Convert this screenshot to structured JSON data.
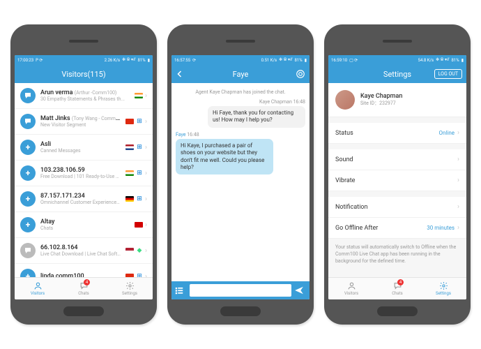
{
  "phone1": {
    "status": {
      "time": "17:00:23",
      "speed": "2.26 K/s",
      "battery": "81%"
    },
    "header": {
      "title": "Visitors(115)"
    },
    "visitors": [
      {
        "icon": "chat",
        "name": "Arun verma",
        "sub": "(Arthur -Comm100)",
        "desc": "30 Empathy Statements & Phrases th...",
        "flag": "in",
        "os": "apple"
      },
      {
        "icon": "chat",
        "name": "Matt Jinks",
        "sub": "(Tony Wang - Comm1...",
        "desc": "New Visitor Segment",
        "flag": "cn",
        "os": "win"
      },
      {
        "icon": "plus",
        "name": "Asli",
        "sub": "",
        "desc": "Canned Messages",
        "flag": "nl",
        "os": "win"
      },
      {
        "icon": "plus",
        "name": "103.238.106.59",
        "sub": "",
        "desc": "Free Download | 101 Ready-to-Use Liv...",
        "flag": "in",
        "os": "win"
      },
      {
        "icon": "plus",
        "name": "87.157.171.234",
        "sub": "",
        "desc": "Omnichannel Customer Experience P...",
        "flag": "de",
        "os": "win"
      },
      {
        "icon": "plus",
        "name": "Altay",
        "sub": "",
        "desc": "Chats",
        "flag": "mk",
        "os": ""
      },
      {
        "icon": "grey",
        "name": "66.102.8.164",
        "sub": "",
        "desc": "Live Chat Download | Live Chat Softw...",
        "flag": "us",
        "os": "android"
      },
      {
        "icon": "plus",
        "name": "linda comm100",
        "sub": "",
        "desc": "",
        "flag": "cn",
        "os": "win"
      }
    ],
    "tabs": {
      "visitors": "Visitors",
      "chats": "Chats",
      "settings": "Settings",
      "badge": "4"
    }
  },
  "phone2": {
    "status": {
      "time": "16:57:55",
      "speed": "0.51 K/s",
      "battery": "81%"
    },
    "header": {
      "title": "Faye"
    },
    "chat": {
      "join": "Agent Kaye Chapman has joined the chat.",
      "msg1": {
        "name": "Kaye Chapman",
        "time": "16:48",
        "text": "Hi Faye, thank you for contacting us! How may I help you?"
      },
      "msg2": {
        "name": "Faye",
        "time": "16:48",
        "text": "Hi Kaye, I purchased a pair of shoes on your website but they don't fit me well. Could you please help?"
      }
    }
  },
  "phone3": {
    "status": {
      "time": "16:59:10",
      "speed": "54.8 K/s",
      "battery": "81%"
    },
    "header": {
      "title": "Settings",
      "logout": "LOG OUT"
    },
    "profile": {
      "name": "Kaye Chapman",
      "site_label": "Site ID：",
      "site_id": "232977"
    },
    "rows": {
      "status_label": "Status",
      "status_val": "Online",
      "sound_label": "Sound",
      "vibrate_label": "Vibrate",
      "notification_label": "Notification",
      "offline_label": "Go Offline After",
      "offline_val": "30 minutes"
    },
    "note": "Your status will automatically switch to Offline when the Comm100 Live Chat app has been running in the background for the defined time.",
    "tabs": {
      "visitors": "Visitors",
      "chats": "Chats",
      "settings": "Settings",
      "badge": "4"
    }
  },
  "flags": {
    "in": "linear-gradient(#ff9933 33%,#fff 33% 66%,#138808 66%)",
    "cn": "#de2910",
    "nl": "linear-gradient(#ae1c28 33%,#fff 33% 66%,#21468b 66%)",
    "de": "linear-gradient(#000 33%,#dd0000 33% 66%,#ffce00 66%)",
    "mk": "#d20000",
    "us": "linear-gradient(#b22234 50%,#fff 50%)"
  }
}
